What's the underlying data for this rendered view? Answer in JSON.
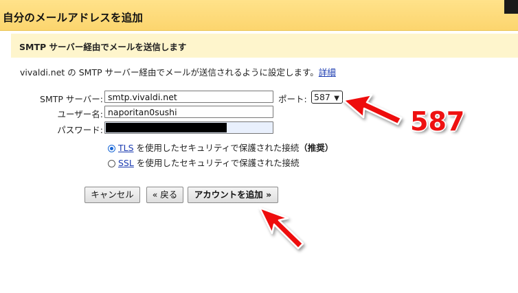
{
  "header": {
    "title": "自分のメールアドレスを追加"
  },
  "section": {
    "heading": "SMTP サーバー経由でメールを送信します"
  },
  "description": {
    "text": "vivaldi.net の SMTP サーバー経由でメールが送信されるように設定します。",
    "link": "詳細"
  },
  "form": {
    "smtp_label": "SMTP サーバー:",
    "smtp_value": "smtp.vivaldi.net",
    "port_label": "ポート:",
    "port_value": "587",
    "username_label": "ユーザー名:",
    "username_value": "naporitan0sushi",
    "password_label": "パスワード:"
  },
  "security": {
    "tls_link": "TLS",
    "tls_text": " を使用したセキュリティで保護された接続",
    "tls_recommended": "（推奨）",
    "ssl_link": "SSL",
    "ssl_text": " を使用したセキュリティで保護された接続",
    "selected": "TLS"
  },
  "buttons": {
    "cancel": "キャンセル",
    "back": "« 戻る",
    "add": "アカウントを追加 »"
  },
  "annotation": {
    "text": "587",
    "color": "#ee1111"
  }
}
